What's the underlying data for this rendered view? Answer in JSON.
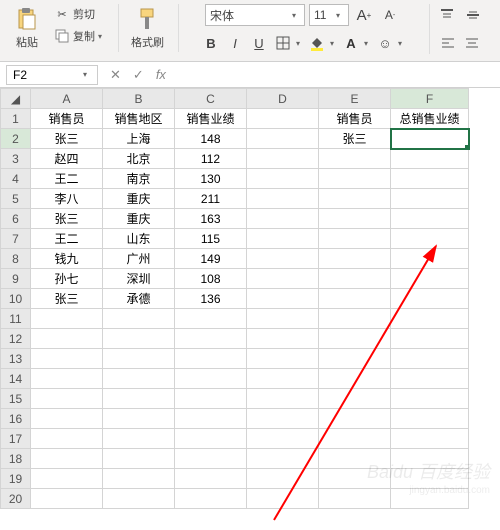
{
  "ribbon": {
    "paste": "粘贴",
    "cut": "剪切",
    "copy": "复制",
    "format_painter": "格式刷",
    "font_name": "宋体",
    "font_size": "11"
  },
  "namebox": "F2",
  "fx": "fx",
  "columns": [
    "A",
    "B",
    "C",
    "D",
    "E",
    "F"
  ],
  "rows": [
    "1",
    "2",
    "3",
    "4",
    "5",
    "6",
    "7",
    "8",
    "9",
    "10",
    "11",
    "12",
    "13",
    "14",
    "15",
    "16",
    "17",
    "18",
    "19",
    "20"
  ],
  "headers": {
    "A": "销售员",
    "B": "销售地区",
    "C": "销售业绩",
    "E": "销售员",
    "F": "总销售业绩"
  },
  "data": [
    {
      "A": "张三",
      "B": "上海",
      "C": "148",
      "E": "张三"
    },
    {
      "A": "赵四",
      "B": "北京",
      "C": "112"
    },
    {
      "A": "王二",
      "B": "南京",
      "C": "130"
    },
    {
      "A": "李八",
      "B": "重庆",
      "C": "211"
    },
    {
      "A": "张三",
      "B": "重庆",
      "C": "163"
    },
    {
      "A": "王二",
      "B": "山东",
      "C": "115"
    },
    {
      "A": "钱九",
      "B": "广州",
      "C": "149"
    },
    {
      "A": "孙七",
      "B": "深圳",
      "C": "108"
    },
    {
      "A": "张三",
      "B": "承德",
      "C": "136"
    }
  ],
  "watermark": "Baidu 百度经验",
  "watermark2": "jingyan.baidu.com"
}
